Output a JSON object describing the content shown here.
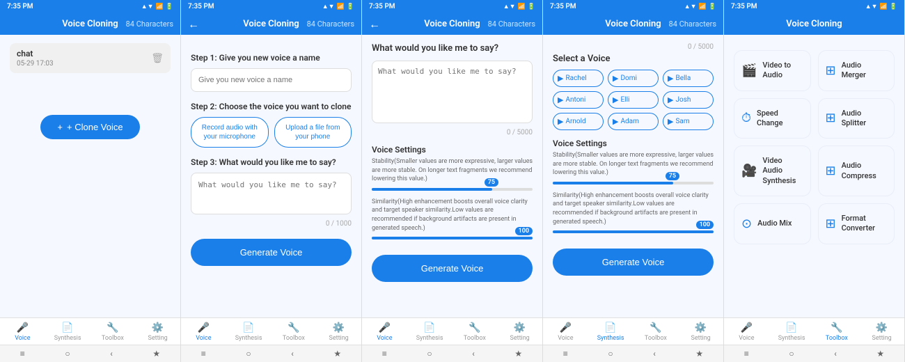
{
  "phones": [
    {
      "id": "phone1",
      "statusBar": {
        "time": "7:35 PM",
        "icons": "▲ ▼ WiFi 📶"
      },
      "header": {
        "title": "Voice Cloning",
        "chars": "84 Characters",
        "hasBack": false
      },
      "activeNav": "voice",
      "screen": "voice-list",
      "chatItems": [
        {
          "name": "chat",
          "date": "05-29 17:03"
        }
      ],
      "cloneBtn": "+ Clone Voice",
      "nav": [
        {
          "id": "voice",
          "label": "Voice",
          "icon": "🎤"
        },
        {
          "id": "synthesis",
          "label": "Synthesis",
          "icon": "📄"
        },
        {
          "id": "toolbox",
          "label": "Toolbox",
          "icon": "🔧"
        },
        {
          "id": "setting",
          "label": "Setting",
          "icon": "⚙️"
        }
      ]
    },
    {
      "id": "phone2",
      "statusBar": {
        "time": "7:35 PM",
        "icons": "▲ ▼ WiFi 📶"
      },
      "header": {
        "title": "Voice Cloning",
        "chars": "84 Characters",
        "hasBack": true
      },
      "activeNav": "voice",
      "screen": "clone-steps",
      "step1Label": "Step 1: Give you new voice a name",
      "step1Placeholder": "Give you new voice a name",
      "step2Label": "Step 2: Choose the voice you want to clone",
      "recordBtn": "Record audio with your microphone",
      "uploadBtn": "Upload a file from your phone",
      "step3Label": "Step 3: What would you like me to say?",
      "step3Placeholder": "What would you like me to say?",
      "counter": "0 / 1000",
      "generateBtn": "Generate Voice",
      "nav": [
        {
          "id": "voice",
          "label": "Voice",
          "icon": "🎤"
        },
        {
          "id": "synthesis",
          "label": "Synthesis",
          "icon": "📄"
        },
        {
          "id": "toolbox",
          "label": "Toolbox",
          "icon": "🔧"
        },
        {
          "id": "setting",
          "label": "Setting",
          "icon": "⚙️"
        }
      ]
    },
    {
      "id": "phone3",
      "statusBar": {
        "time": "7:35 PM",
        "icons": "▲ ▼ WiFi 📶"
      },
      "header": {
        "title": "Voice Cloning",
        "chars": "84 Characters",
        "hasBack": true
      },
      "activeNav": "voice",
      "screen": "say-text",
      "sayLabel": "What would you like me to say?",
      "sayPlaceholder": "What would you like me to say?",
      "counterTop": "0 / 5000",
      "settingsTitle": "Voice Settings",
      "stabilityDesc": "Stability(Smaller values are more expressive, larger values are more stable. On longer text fragments we recommend lowering this value.)",
      "stabilityValue": 75,
      "similarityDesc": "Similarity(High enhancement boosts overall voice clarity and target speaker similarity.Low values are recommended if background artifacts are present in generated speech.)",
      "similarityValue": 100,
      "generateBtn": "Generate Voice",
      "nav": [
        {
          "id": "voice",
          "label": "Voice",
          "icon": "🎤"
        },
        {
          "id": "synthesis",
          "label": "Synthesis",
          "icon": "📄"
        },
        {
          "id": "toolbox",
          "label": "Toolbox",
          "icon": "🔧"
        },
        {
          "id": "setting",
          "label": "Setting",
          "icon": "⚙️"
        }
      ]
    },
    {
      "id": "phone4",
      "statusBar": {
        "time": "7:35 PM",
        "icons": "▲ ▼ WiFi 📶"
      },
      "header": {
        "title": "Voice Cloning",
        "chars": "84 Characters",
        "hasBack": false
      },
      "activeNav": "synthesis",
      "screen": "select-voice",
      "counterTop": "0 / 5000",
      "selectVoiceTitle": "Select a Voice",
      "voices": [
        {
          "name": "Rachel"
        },
        {
          "name": "Domi"
        },
        {
          "name": "Bella"
        },
        {
          "name": "Antoni"
        },
        {
          "name": "Elli"
        },
        {
          "name": "Josh"
        },
        {
          "name": "Arnold"
        },
        {
          "name": "Adam"
        },
        {
          "name": "Sam"
        }
      ],
      "settingsTitle": "Voice Settings",
      "stabilityDesc": "Stability(Smaller values are more expressive, larger values are more stable. On longer text fragments we recommend lowering this value.)",
      "stabilityValue": 75,
      "similarityDesc": "Similarity(High enhancement boosts overall voice clarity and target speaker similarity.Low values are recommended if background artifacts are present in generated speech.)",
      "similarityValue": 100,
      "generateBtn": "Generate Voice",
      "nav": [
        {
          "id": "voice",
          "label": "Voice",
          "icon": "🎤"
        },
        {
          "id": "synthesis",
          "label": "Synthesis",
          "icon": "📄"
        },
        {
          "id": "toolbox",
          "label": "Toolbox",
          "icon": "🔧"
        },
        {
          "id": "setting",
          "label": "Setting",
          "icon": "⚙️"
        }
      ]
    },
    {
      "id": "phone5",
      "statusBar": {
        "time": "7:35 PM",
        "icons": "▲ ▼ WiFi 📶"
      },
      "header": {
        "title": "Voice Cloning",
        "hasBack": false
      },
      "activeNav": "toolbox",
      "screen": "toolbox",
      "tools": [
        {
          "id": "video-to-audio",
          "icon": "🎬",
          "label": "Video to Audio"
        },
        {
          "id": "audio-merger",
          "icon": "⊞",
          "label": "Audio Merger"
        },
        {
          "id": "speed-change",
          "icon": "⏱",
          "label": "Speed Change"
        },
        {
          "id": "audio-splitter",
          "icon": "⊞",
          "label": "Audio Splitter"
        },
        {
          "id": "video-audio-synthesis",
          "icon": "🎥",
          "label": "Video Audio Synthesis"
        },
        {
          "id": "audio-compress",
          "icon": "⊞",
          "label": "Audio Compress"
        },
        {
          "id": "audio-mix",
          "icon": "⊙",
          "label": "Audio Mix"
        },
        {
          "id": "format-converter",
          "icon": "⊞",
          "label": "Format Converter"
        }
      ],
      "nav": [
        {
          "id": "voice",
          "label": "Voice",
          "icon": "🎤"
        },
        {
          "id": "synthesis",
          "label": "Synthesis",
          "icon": "📄"
        },
        {
          "id": "toolbox",
          "label": "Toolbox",
          "icon": "🔧"
        },
        {
          "id": "setting",
          "label": "Setting",
          "icon": "⚙️"
        }
      ]
    }
  ],
  "androidBtns": [
    "≡",
    "○",
    "‹",
    "★"
  ]
}
